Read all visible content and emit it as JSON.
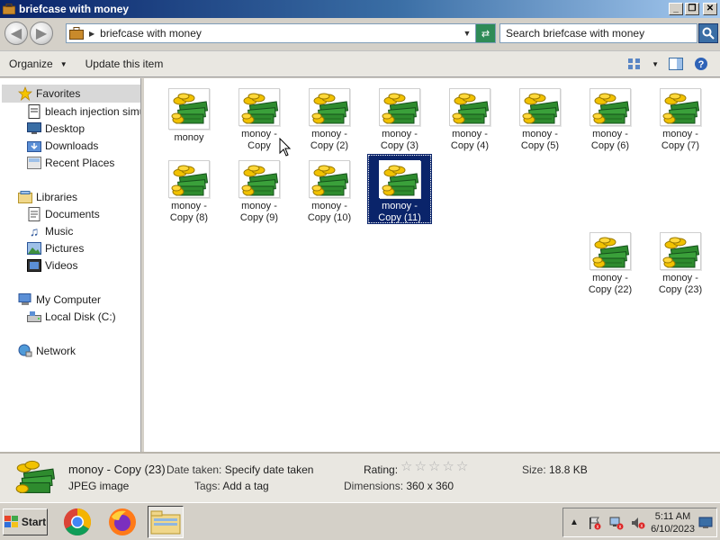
{
  "window": {
    "title": "briefcase with money"
  },
  "address": {
    "path": "briefcase with money",
    "search_placeholder": "Search briefcase with money"
  },
  "command_bar": {
    "organize": "Organize",
    "update": "Update this item"
  },
  "nav": {
    "favorites": "Favorites",
    "favorites_items": [
      "bleach injection simula",
      "Desktop",
      "Downloads",
      "Recent Places"
    ],
    "libraries": "Libraries",
    "libraries_items": [
      "Documents",
      "Music",
      "Pictures",
      "Videos"
    ],
    "computer": "My Computer",
    "computer_items": [
      "Local Disk (C:)"
    ],
    "network": "Network"
  },
  "files": [
    {
      "line1": "monoy",
      "line2": ""
    },
    {
      "line1": "monoy -",
      "line2": "Copy"
    },
    {
      "line1": "monoy -",
      "line2": "Copy (2)"
    },
    {
      "line1": "monoy -",
      "line2": "Copy (3)"
    },
    {
      "line1": "monoy -",
      "line2": "Copy (4)"
    },
    {
      "line1": "monoy -",
      "line2": "Copy (5)"
    },
    {
      "line1": "monoy -",
      "line2": "Copy (6)"
    },
    {
      "line1": "monoy -",
      "line2": "Copy (7)"
    },
    {
      "line1": "monoy -",
      "line2": "Copy (8)"
    },
    {
      "line1": "monoy -",
      "line2": "Copy (9)"
    },
    {
      "line1": "monoy -",
      "line2": "Copy (10)"
    },
    {
      "line1": "monoy -",
      "line2": "Copy (11)",
      "selected": true
    },
    {
      "line1": "monoy -",
      "line2": "Copy (22)"
    },
    {
      "line1": "monoy -",
      "line2": "Copy (23)"
    }
  ],
  "details": {
    "name": "monoy - Copy (23)",
    "type": "JPEG image",
    "date_label": "Date taken:",
    "date_value": "Specify date taken",
    "tags_label": "Tags:",
    "tags_value": "Add a tag",
    "rating_label": "Rating:",
    "dimensions_label": "Dimensions:",
    "dimensions_value": "360 x 360",
    "size_label": "Size:",
    "size_value": "18.8 KB"
  },
  "taskbar": {
    "start": "Start",
    "time": "5:11 AM",
    "date": "6/10/2023"
  },
  "colors": {
    "title_gradient_start": "#0a246a",
    "selection": "#0a246a",
    "money_green": "#2e8b2e",
    "coin_gold": "#f2c200"
  }
}
